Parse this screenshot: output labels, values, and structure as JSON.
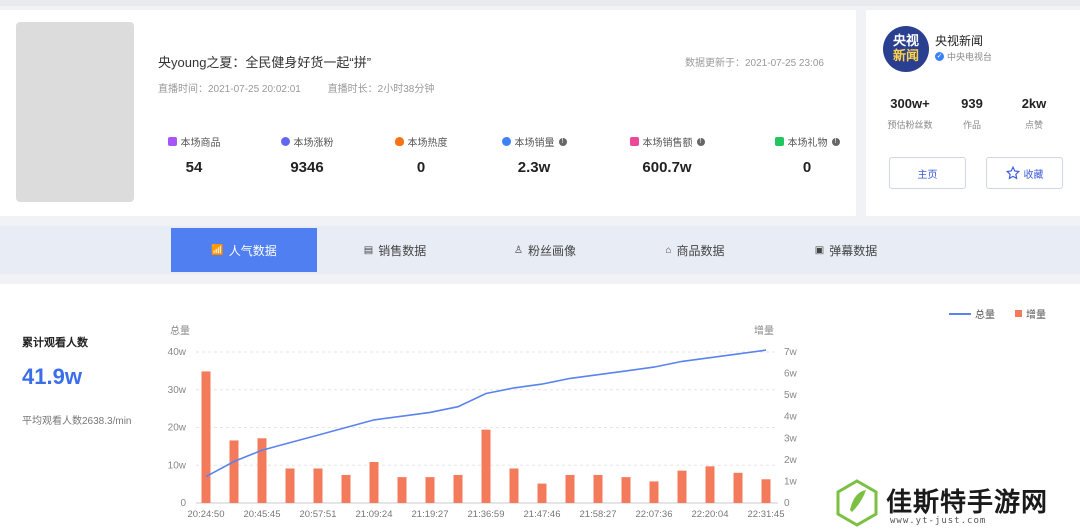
{
  "live": {
    "title": "央young之夏：全民健身好货一起“拼”",
    "start_time": "直播时间：2021-07-25 20:02:01",
    "duration": "直播时长：2小时38分钟",
    "updated": "数据更新于：2021-07-25 23:06"
  },
  "stats": [
    {
      "label": "本场商品",
      "value": "54",
      "icon": "bag-icon",
      "color": "#a855f7"
    },
    {
      "label": "本场涨粉",
      "value": "9346",
      "icon": "user-add-icon",
      "color": "#6366f1"
    },
    {
      "label": "本场热度",
      "value": "0",
      "icon": "fire-icon",
      "color": "#f97316"
    },
    {
      "label": "本场销量",
      "value": "2.3w",
      "icon": "sales-icon",
      "color": "#3b82f6"
    },
    {
      "label": "本场销售额",
      "value": "600.7w",
      "icon": "money-bag-icon",
      "color": "#ec4899"
    },
    {
      "label": "本场礼物",
      "value": "0",
      "icon": "gift-icon",
      "color": "#22c55e"
    }
  ],
  "author": {
    "logo_text_1": "央视",
    "logo_text_2": "新闻",
    "name": "央视新闻",
    "org": "中央电视台",
    "stats": [
      {
        "value": "300w+",
        "label": "预估粉丝数"
      },
      {
        "value": "939",
        "label": "作品"
      },
      {
        "value": "2kw",
        "label": "点赞"
      }
    ],
    "home_label": "主页",
    "fav_label": "收藏"
  },
  "tabs": [
    {
      "label": "人气数据",
      "icon": "trend-icon"
    },
    {
      "label": "销售数据",
      "icon": "receipt-icon"
    },
    {
      "label": "粉丝画像",
      "icon": "fans-icon"
    },
    {
      "label": "商品数据",
      "icon": "product-icon"
    },
    {
      "label": "弹幕数据",
      "icon": "danmaku-icon"
    }
  ],
  "panel": {
    "title": "累计观看人数",
    "value": "41.9w",
    "subtitle": "平均观看人数2638.3/min"
  },
  "chart_data": {
    "type": "bar",
    "legend": [
      {
        "name": "总量",
        "kind": "line",
        "color": "#5b83ef"
      },
      {
        "name": "增量",
        "kind": "bar",
        "color": "#f47a5c"
      }
    ],
    "legend_position": "top-right",
    "y_left_label": "总量",
    "y_right_label": "增量",
    "y_left_ticks": [
      "40w",
      "30w",
      "20w",
      "10w",
      "0"
    ],
    "y_right_ticks": [
      "7w",
      "6w",
      "5w",
      "4w",
      "3w",
      "2w",
      "1w",
      "0"
    ],
    "y_left_range": [
      0,
      40
    ],
    "y_right_range": [
      0,
      7
    ],
    "x_tick_labels": [
      "20:24:50",
      "20:45:45",
      "20:57:51",
      "21:09:24",
      "21:19:27",
      "21:36:59",
      "21:47:46",
      "21:58:27",
      "22:07:36",
      "22:20:04",
      "22:31:45"
    ],
    "grid": true,
    "series": [
      {
        "name": "增量",
        "type": "bar",
        "values": [
          6.1,
          2.9,
          3.0,
          1.6,
          1.6,
          1.3,
          1.9,
          1.2,
          1.2,
          1.3,
          3.4,
          1.6,
          0.9,
          1.3,
          1.3,
          1.2,
          1.0,
          1.5,
          1.7,
          1.4,
          1.1
        ]
      },
      {
        "name": "总量",
        "type": "line",
        "values": [
          7,
          11,
          14,
          16,
          18,
          20,
          22,
          23,
          24,
          25.5,
          29,
          30.5,
          31.5,
          33,
          34,
          35,
          36,
          37.5,
          38.5,
          39.5,
          40.5
        ]
      }
    ]
  },
  "watermark": {
    "text": "佳斯特手游网",
    "url": "www.yt-just.com"
  }
}
